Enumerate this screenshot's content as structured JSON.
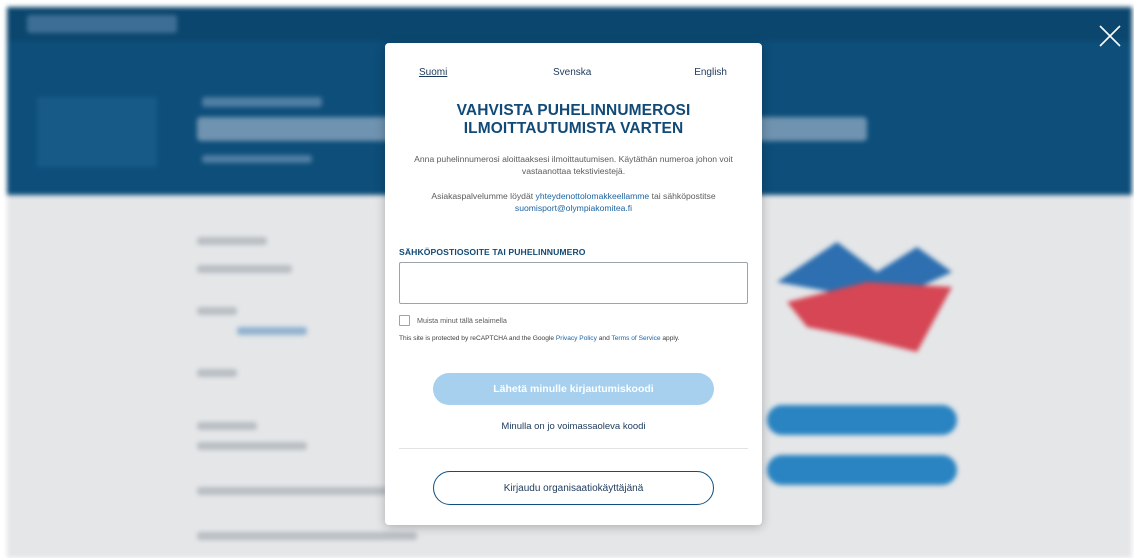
{
  "languages": [
    {
      "label": "Suomi",
      "active": true
    },
    {
      "label": "Svenska",
      "active": false
    },
    {
      "label": "English",
      "active": false
    }
  ],
  "modal": {
    "title_line1": "VAHVISTA PUHELINNUMEROSI",
    "title_line2": "ILMOITTAUTUMISTA VARTEN",
    "intro": "Anna puhelinnumerosi aloittaaksesi ilmoittautumisen. Käytäthän numeroa johon voit vastaanottaa tekstiviestejä.",
    "support_prefix": "Asiakaspalvelumme löydät ",
    "support_link": "yhteydenottolomakkeellamme",
    "support_middle": " tai sähköpostitse ",
    "support_email": "suomisport@olympiakomitea.fi",
    "field_label": "SÄHKÖPOSTIOSOITE TAI PUHELINNUMERO",
    "field_value": "",
    "field_placeholder": "",
    "remember_label": "Muista minut tällä selaimella",
    "recaptcha_prefix": "This site is protected by reCAPTCHA and the Google ",
    "privacy_link": "Privacy Policy",
    "recaptcha_and": " and ",
    "terms_link": "Terms of Service",
    "recaptcha_suffix": " apply.",
    "send_button": "Lähetä minulle kirjautumiskoodi",
    "have_code_link": "Minulla on jo voimassaoleva koodi",
    "org_button": "Kirjaudu organisaatiokäyttäjänä"
  },
  "icons": {
    "close": "close-icon",
    "checkbox": "checkbox-icon"
  },
  "colors": {
    "title": "#114a77",
    "link": "#1a63a3",
    "send_button_bg": "#a6d0ee",
    "org_button_border": "#0f4f7f",
    "header_bg": "#0d4e7a"
  }
}
